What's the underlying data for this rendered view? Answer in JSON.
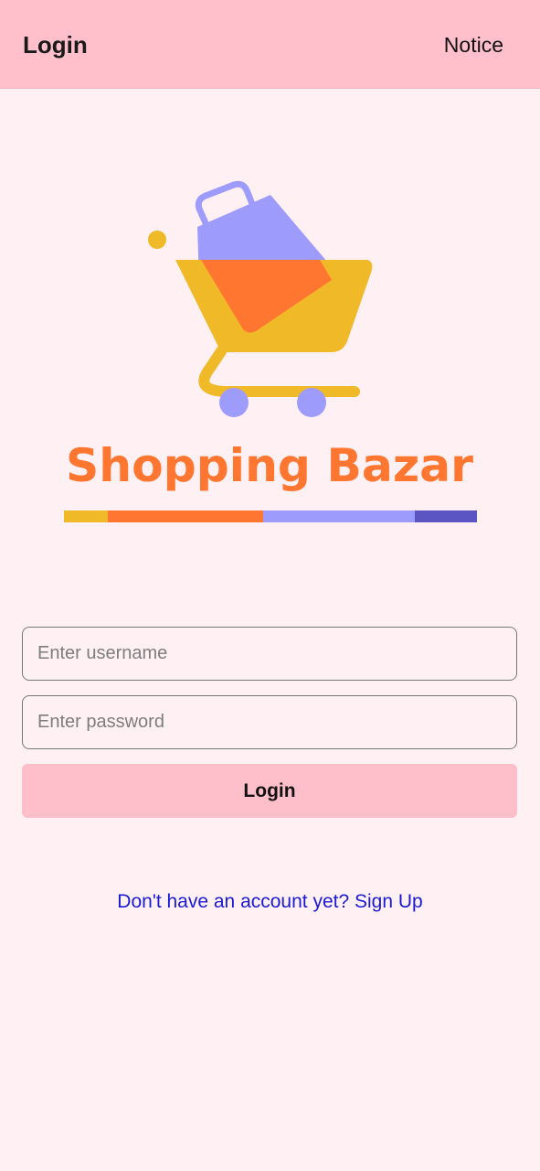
{
  "header": {
    "title": "Login",
    "notice_label": "Notice"
  },
  "logo": {
    "brand_text": "Shopping Bazar",
    "icon": "shopping-cart-icon",
    "colors": {
      "yellow": "#f0b928",
      "orange": "#ff7631",
      "lavender": "#9d9cfd",
      "indigo": "#5b55c4"
    }
  },
  "form": {
    "username_placeholder": "Enter username",
    "password_placeholder": "Enter password",
    "login_label": "Login"
  },
  "signup": {
    "link_text": "Don't have an account yet? Sign Up"
  },
  "theme": {
    "header_bg": "#ffc0cb",
    "page_bg": "#fff0f4",
    "button_bg": "#ffbfca",
    "link_color": "#1a1ad6"
  }
}
